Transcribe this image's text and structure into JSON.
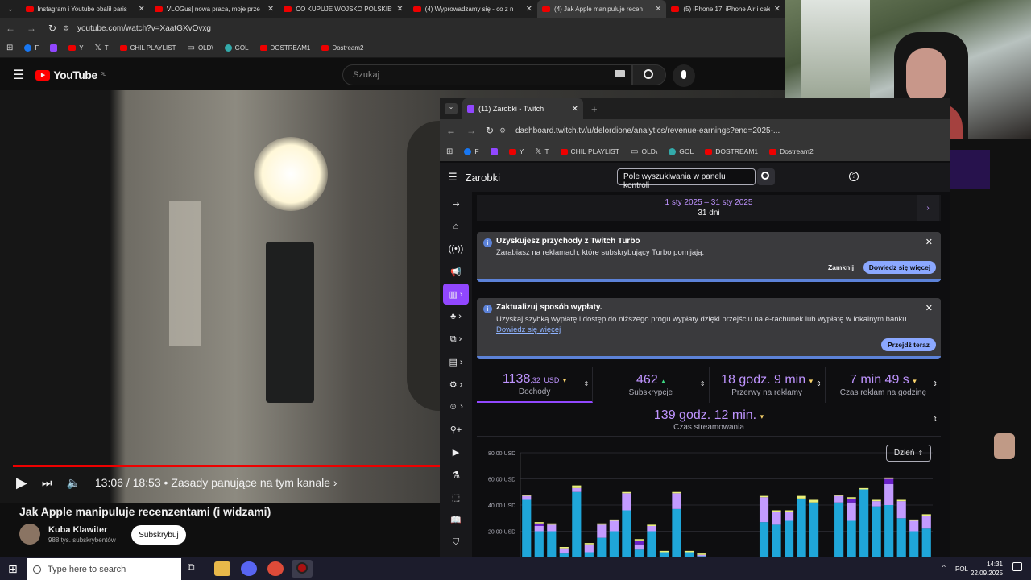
{
  "back_browser": {
    "tabs": [
      {
        "title": "Instagram i Youtube obalił paris"
      },
      {
        "title": "VLOGus| nowa praca, moje prze"
      },
      {
        "title": "CO KUPUJE WOJSKO POLSKIE?"
      },
      {
        "title": "(4) Wyprowadzamy się - co z n"
      },
      {
        "title": "(4) Jak Apple manipuluje recen"
      },
      {
        "title": "(5) iPhone 17, iPhone Air i całe"
      }
    ],
    "url": "youtube.com/watch?v=XaatGXvOvxg",
    "bookmarks": [
      "F",
      "",
      "Y",
      "T",
      "CHIL PLAYLIST",
      "OLD\\",
      "GOL",
      "DOSTREAM1",
      "Dostream2"
    ]
  },
  "youtube": {
    "logo": "YouTube",
    "region": "PL",
    "search_placeholder": "Szukaj",
    "time": "13:06 / 18:53",
    "chapter": "• Zasady panujące na tym kanale ›",
    "video_title": "Jak Apple manipuluje recenzentami (i widzami)",
    "channel_name": "Kuba Klawiter",
    "subscribers": "988 tys. subskrybentów",
    "subscribe_label": "Subskrybuj",
    "progress": 1.0
  },
  "twitch": {
    "tab_title": "(11) Zarobki - Twitch",
    "url": "dashboard.twitch.tv/u/delordione/analytics/revenue-earnings?end=2025-...",
    "bookmarks": [
      "F",
      "",
      "Y",
      "T",
      "CHIL PLAYLIST",
      "OLD\\",
      "GOL",
      "DOSTREAM1",
      "Dostream2"
    ],
    "page_title": "Zarobki",
    "search_placeholder": "Pole wyszukiwania w panelu kontroli",
    "date_range": "1 sty 2025 – 31 sty 2025",
    "days": "31 dni",
    "notice1": {
      "title": "Uzyskujesz przychody z Twitch Turbo",
      "text": "Zarabiasz na reklamach, które subskrybujący Turbo pomijają.",
      "dismiss": "Zamknij",
      "learn": "Dowiedz się więcej"
    },
    "notice2": {
      "title": "Zaktualizuj sposób wypłaty.",
      "text": "Uzyskaj szybką wypłatę i dostęp do niższego progu wypłaty dzięki przejściu na e-rachunek lub wypłatę w lokalnym banku.",
      "link": "Dowiedz się więcej",
      "action": "Przejdź teraz"
    },
    "stats": [
      {
        "value": "1138",
        "decimals": ",32",
        "unit": "USD",
        "label": "Dochody"
      },
      {
        "value": "462",
        "decimals": "",
        "unit": "",
        "label": "Subskrypcje"
      },
      {
        "value": "18 godz. 9 min",
        "decimals": "",
        "unit": "",
        "label": "Przerwy na reklamy"
      },
      {
        "value": "7 min 49 s",
        "decimals": "",
        "unit": "",
        "label": "Czas reklam na godzinę"
      }
    ],
    "stream_time": {
      "value": "139 godz. 12 min.",
      "label": "Czas streamowania"
    },
    "granularity": "Dzień"
  },
  "chart_data": {
    "type": "bar",
    "stacked": true,
    "y_ticks": [
      "80,00 USD",
      "60,00 USD",
      "40,00 USD",
      "20,00 USD"
    ],
    "ylim": [
      0,
      80
    ],
    "colors": {
      "lightblue": "#1fa6d9",
      "violet": "#c39bff",
      "darkviolet": "#6a20c9",
      "top": "#e9f07a"
    },
    "series": [
      {
        "color": "lightblue",
        "values": [
          44,
          20,
          20,
          3,
          50,
          4,
          15,
          20,
          36,
          6,
          20,
          4,
          37,
          4,
          1,
          0,
          0,
          0,
          0,
          27,
          25,
          28,
          45,
          42,
          0,
          42,
          28,
          52,
          39,
          40,
          30,
          20,
          22
        ]
      },
      {
        "color": "violet",
        "values": [
          3,
          4,
          5,
          4,
          3,
          6,
          10,
          8,
          13,
          4,
          4,
          0,
          12,
          0,
          1,
          0,
          0,
          0,
          0,
          19,
          10,
          7,
          0,
          0,
          0,
          5,
          14,
          0,
          4,
          16,
          13,
          8,
          10
        ]
      },
      {
        "color": "darkviolet",
        "values": [
          0,
          2,
          0,
          0,
          0,
          0,
          0,
          0,
          0,
          3,
          0,
          0,
          0,
          0,
          0,
          0,
          0,
          0,
          0,
          0,
          0,
          0,
          0,
          0,
          0,
          0,
          3,
          0,
          0,
          4,
          0,
          0,
          0
        ]
      },
      {
        "color": "top",
        "values": [
          1,
          1,
          1,
          1,
          2,
          1,
          1,
          1,
          1,
          1,
          1,
          1,
          1,
          1,
          1,
          0,
          0,
          0,
          0,
          1,
          1,
          1,
          2,
          2,
          0,
          1,
          1,
          1,
          1,
          1,
          1,
          1,
          1
        ]
      }
    ]
  },
  "taskbar": {
    "search_placeholder": "Type here to search",
    "lang": "POL",
    "time": "14:31",
    "date": "22.09.2025"
  }
}
